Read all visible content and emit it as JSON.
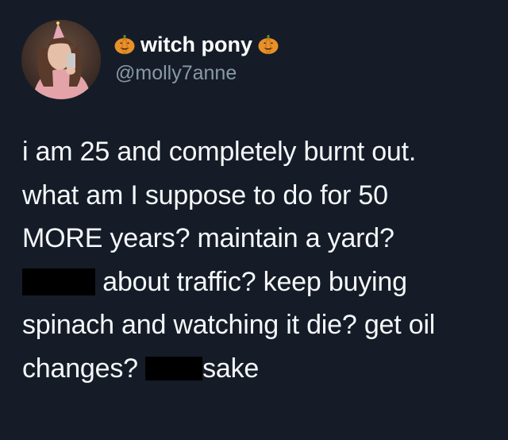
{
  "author": {
    "display_name": "witch pony",
    "handle": "@molly7anne",
    "name_emoji_left": "pumpkin-icon",
    "name_emoji_right": "pumpkin-icon"
  },
  "tweet": {
    "line1": "i am 25 and completely burnt out.",
    "line2": "what am I suppose to do for 50",
    "line3": "MORE years? maintain a yard?",
    "line4_after_redaction": "about traffic? keep buying",
    "line5": "spinach and watching it die? get oil",
    "line6_before_redaction": "changes?",
    "line6_after_redaction": "sake"
  },
  "colors": {
    "background": "#151c27",
    "text": "#f5f8fa",
    "handle": "#8899a6",
    "redaction": "#000000",
    "pumpkin": "#e8912a"
  }
}
